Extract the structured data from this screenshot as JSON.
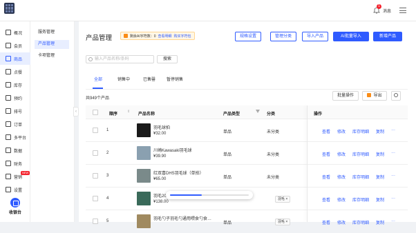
{
  "header": {
    "notification_count": "1",
    "message_label": "消息"
  },
  "left_nav": {
    "items": [
      {
        "label": "概况"
      },
      {
        "label": "会员"
      },
      {
        "label": "商品"
      },
      {
        "label": "点餐"
      },
      {
        "label": "库存"
      },
      {
        "label": "预约"
      },
      {
        "label": "排号"
      },
      {
        "label": "订单"
      },
      {
        "label": "多平台"
      },
      {
        "label": "数据"
      },
      {
        "label": "财务"
      },
      {
        "label": "营销",
        "badge": "NEW"
      },
      {
        "label": "设置"
      }
    ],
    "active_index": 2,
    "workbench_label": "收银台"
  },
  "sub_nav": {
    "items": [
      {
        "label": "服务管理"
      },
      {
        "label": "产品管理"
      },
      {
        "label": "卡项管理"
      }
    ],
    "active_index": 1
  },
  "page": {
    "title": "产品管理",
    "quota": {
      "text": "剩余AI字符数：0",
      "view_link": "查看明细",
      "buy_link": "购买字符包"
    },
    "buttons": {
      "attr_settings": "规格设置",
      "category_manage": "管理分类",
      "import": "导入产品",
      "ai_import": "AI批量导入",
      "new_product": "新增产品"
    },
    "search": {
      "placeholder": "输入产品名称/条码",
      "button": "搜索"
    },
    "tabs": [
      "全部",
      "销售中",
      "已售罄",
      "暂停销售"
    ],
    "active_tab": 0,
    "total_text": "共949个产品",
    "bulk_label": "批量操作",
    "export_label": "导出"
  },
  "table": {
    "columns": {
      "seq": "顺序",
      "name": "产品名称",
      "type": "产品类型",
      "category": "分类",
      "actions": "操作"
    },
    "actions": [
      "查看",
      "修改",
      "库存明细",
      "复制",
      "···"
    ],
    "rows": [
      {
        "seq": "1",
        "name": "羽毛球拍",
        "price": "¥32.00",
        "type": "单品",
        "category": "未分类",
        "thumb_color": "#1a1a1a"
      },
      {
        "seq": "2",
        "name": "川崎Kawasaki羽毛球",
        "price": "¥39.90",
        "type": "单品",
        "category": "未分类",
        "thumb_color": "#8aa0b0"
      },
      {
        "seq": "3",
        "name": "红双喜DHS羽毛球（单拍）",
        "price": "¥65.00",
        "type": "单品",
        "category": "未分类",
        "thumb_color": "#7a8a8a"
      },
      {
        "seq": "4",
        "name": "羽毛20",
        "price": "¥138.00",
        "type": "",
        "category": "",
        "tag": "羽毛",
        "thumb_color": "#3a6a5a"
      },
      {
        "seq": "5",
        "name": "羽毛勺子羽毛勺通用喂食勺食…",
        "price": "",
        "type": "单品",
        "category": "",
        "tag": "羽毛",
        "thumb_color": "#a08a60"
      }
    ]
  },
  "loading": {
    "progress": 0.4
  }
}
